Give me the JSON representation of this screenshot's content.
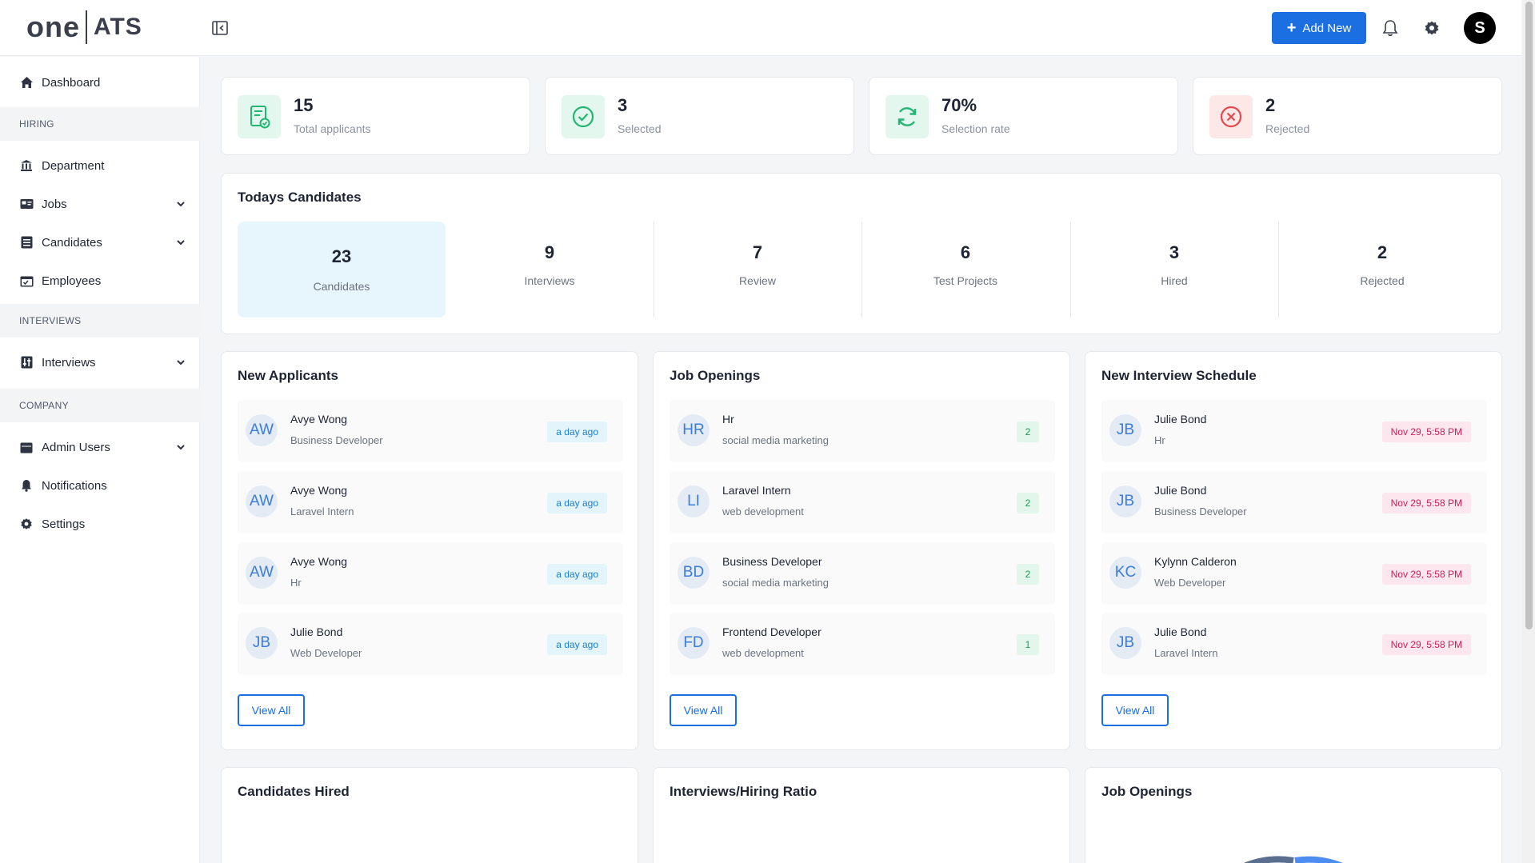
{
  "brand": {
    "part1": "one",
    "part2": "ATS"
  },
  "topbar": {
    "add_new_label": "Add New",
    "avatar_letter": "S",
    "icons": [
      "collapse-sidebar-icon",
      "bell-icon",
      "gear-icon"
    ]
  },
  "sidebar": {
    "dashboard": "Dashboard",
    "section_hiring": "HIRING",
    "department": "Department",
    "jobs": "Jobs",
    "candidates": "Candidates",
    "employees": "Employees",
    "section_interviews": "INTERVIEWS",
    "interviews": "Interviews",
    "section_company": "COMPANY",
    "admin_users": "Admin Users",
    "notifications": "Notifications",
    "settings": "Settings"
  },
  "stats": [
    {
      "value": "15",
      "label": "Total applicants",
      "color": "#22b573"
    },
    {
      "value": "3",
      "label": "Selected",
      "color": "#22b573"
    },
    {
      "value": "70%",
      "label": "Selection rate",
      "color": "#22b573"
    },
    {
      "value": "2",
      "label": "Rejected",
      "color": "#e5484d"
    }
  ],
  "today": {
    "title": "Todays Candidates",
    "cells": [
      {
        "value": "23",
        "label": "Candidates"
      },
      {
        "value": "9",
        "label": "Interviews"
      },
      {
        "value": "7",
        "label": "Review"
      },
      {
        "value": "6",
        "label": "Test Projects"
      },
      {
        "value": "3",
        "label": "Hired"
      },
      {
        "value": "2",
        "label": "Rejected"
      }
    ]
  },
  "new_applicants": {
    "title": "New Applicants",
    "items": [
      {
        "initials": "AW",
        "name": "Avye Wong",
        "role": "Business Developer",
        "time": "a day ago"
      },
      {
        "initials": "AW",
        "name": "Avye Wong",
        "role": "Laravel Intern",
        "time": "a day ago"
      },
      {
        "initials": "AW",
        "name": "Avye Wong",
        "role": "Hr",
        "time": "a day ago"
      },
      {
        "initials": "JB",
        "name": "Julie Bond",
        "role": "Web Developer",
        "time": "a day ago"
      }
    ],
    "view_all": "View All"
  },
  "job_openings": {
    "title": "Job Openings",
    "items": [
      {
        "initials": "HR",
        "name": "Hr",
        "dept": "social media marketing",
        "count": "2"
      },
      {
        "initials": "LI",
        "name": "Laravel Intern",
        "dept": "web development",
        "count": "2"
      },
      {
        "initials": "BD",
        "name": "Business Developer",
        "dept": "social media marketing",
        "count": "2"
      },
      {
        "initials": "FD",
        "name": "Frontend Developer",
        "dept": "web development",
        "count": "1"
      }
    ],
    "view_all": "View All"
  },
  "interview_schedule": {
    "title": "New Interview Schedule",
    "items": [
      {
        "initials": "JB",
        "name": "Julie Bond",
        "role": "Hr",
        "date": "Nov 29, 5:58 PM"
      },
      {
        "initials": "JB",
        "name": "Julie Bond",
        "role": "Business Developer",
        "date": "Nov 29, 5:58 PM"
      },
      {
        "initials": "KC",
        "name": "Kylynn Calderon",
        "role": "Web Developer",
        "date": "Nov 29, 5:58 PM"
      },
      {
        "initials": "JB",
        "name": "Julie Bond",
        "role": "Laravel Intern",
        "date": "Nov 29, 5:58 PM"
      }
    ],
    "view_all": "View All"
  },
  "bottom": {
    "candidates_hired": "Candidates Hired",
    "ratio": "Interviews/Hiring Ratio",
    "job_openings": "Job Openings"
  }
}
